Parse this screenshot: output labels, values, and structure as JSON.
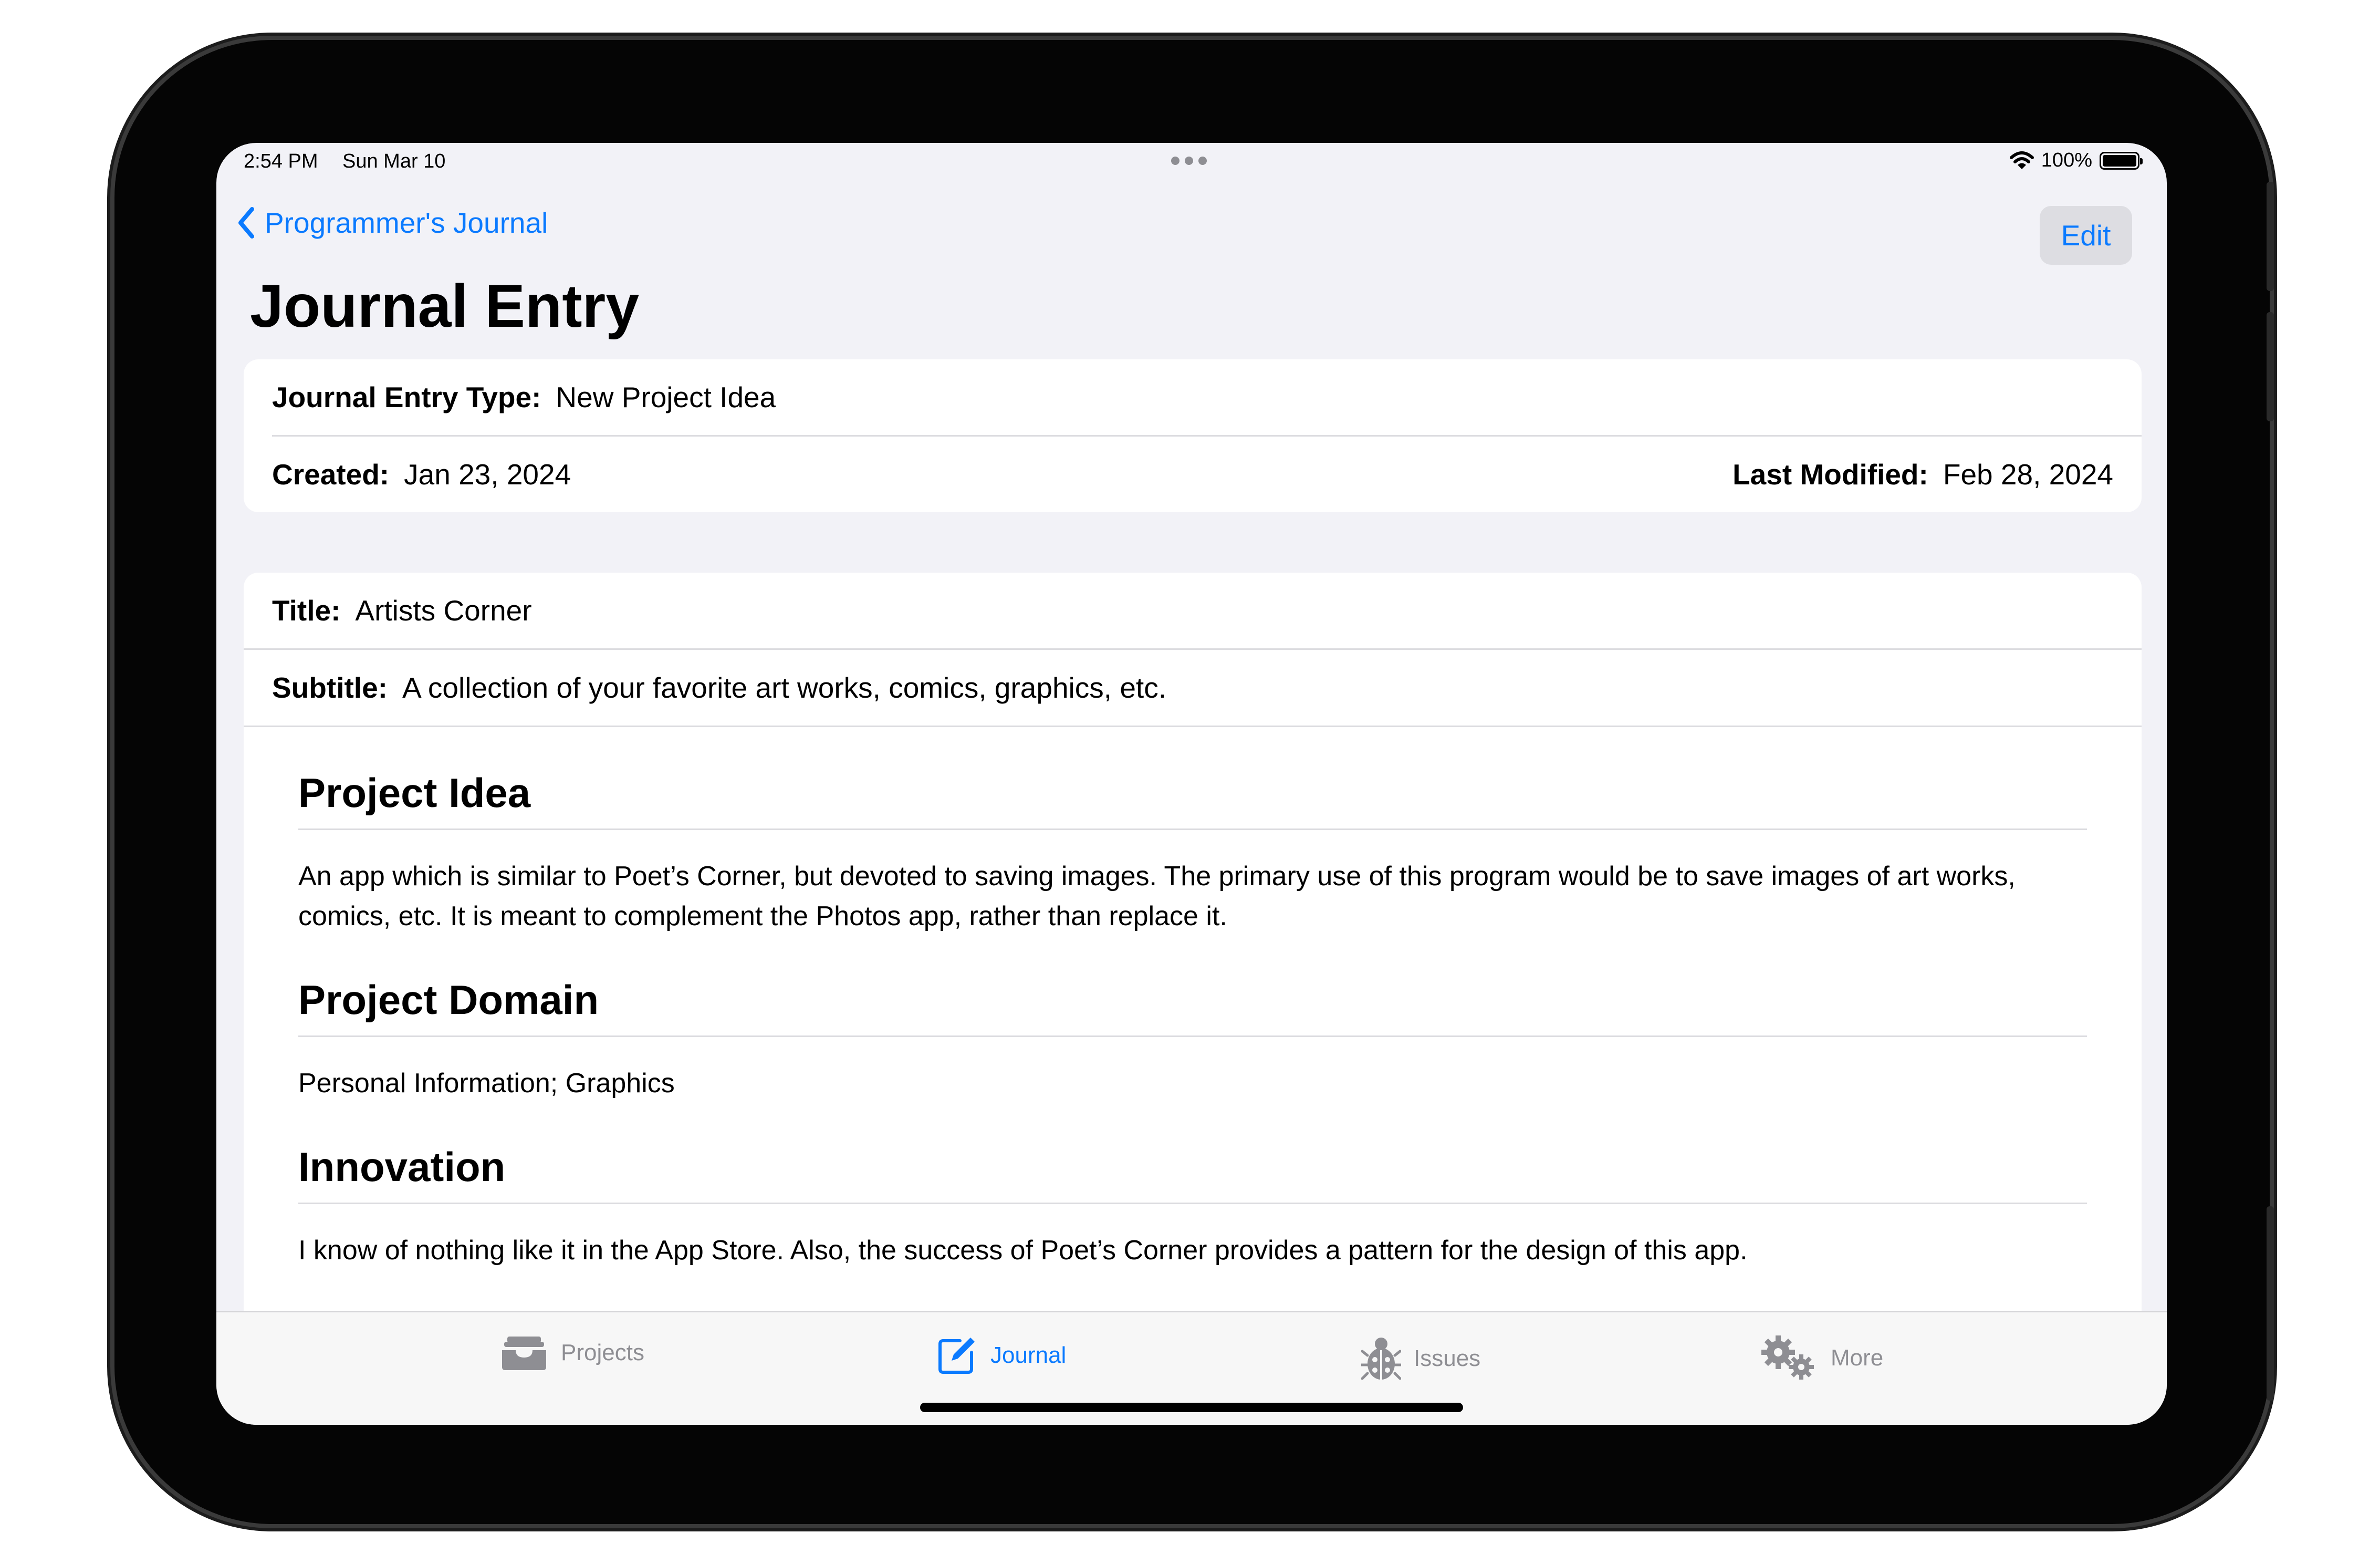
{
  "status_bar": {
    "time": "2:54 PM",
    "date": "Sun Mar 10",
    "battery": "100%"
  },
  "nav": {
    "back_label": "Programmer's Journal",
    "edit_label": "Edit"
  },
  "page_title": "Journal Entry",
  "meta": {
    "type_label": "Journal Entry Type:",
    "type_value": "New Project Idea",
    "created_label": "Created:",
    "created_value": "Jan 23, 2024",
    "modified_label": "Last Modified:",
    "modified_value": "Feb 28, 2024"
  },
  "entry": {
    "title_label": "Title:",
    "title_value": "Artists Corner",
    "subtitle_label": "Subtitle:",
    "subtitle_value": "A collection of your favorite art works, comics, graphics, etc.",
    "sections": [
      {
        "heading": "Project Idea",
        "text": "An app which is similar to Poet’s Corner, but devoted to saving images. The primary use of this program would be to save images of art works, comics, etc. It is meant to complement the Photos app, rather than replace it."
      },
      {
        "heading": "Project Domain",
        "text": "Personal Information; Graphics"
      },
      {
        "heading": "Innovation",
        "text": "I know of nothing like it in the App Store. Also, the success of Poet’s Corner provides a pattern for the design of this app."
      }
    ]
  },
  "tabs": [
    {
      "label": "Projects",
      "icon": "tray-icon",
      "active": false
    },
    {
      "label": "Journal",
      "icon": "square-pencil-icon",
      "active": true
    },
    {
      "label": "Issues",
      "icon": "ladybug-icon",
      "active": false
    },
    {
      "label": "More",
      "icon": "gears-icon",
      "active": false
    }
  ],
  "colors": {
    "accent": "#0a7aff",
    "inactive_tab": "#8e8e93",
    "background": "#f2f2f7"
  }
}
